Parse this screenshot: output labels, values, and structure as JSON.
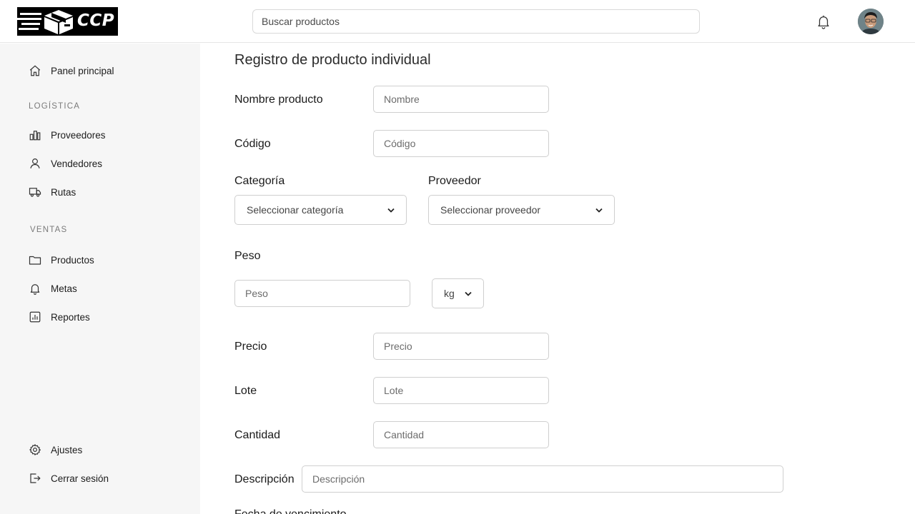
{
  "header": {
    "logo_text": "CCP",
    "search_placeholder": "Buscar productos"
  },
  "sidebar": {
    "home": "Panel principal",
    "section_logistica": "LOGÍSTICA",
    "logistica_items": [
      "Proveedores",
      "Vendedores",
      "Rutas"
    ],
    "section_ventas": "VENTAS",
    "ventas_items": [
      "Productos",
      "Metas",
      "Reportes"
    ],
    "settings": "Ajustes",
    "logout": "Cerrar sesión"
  },
  "form": {
    "title": "Registro de producto individual",
    "nombre_label": "Nombre producto",
    "nombre_placeholder": "Nombre",
    "codigo_label": "Código",
    "codigo_placeholder": "Código",
    "categoria_label": "Categoría",
    "categoria_select": "Seleccionar categoría",
    "proveedor_label": "Proveedor",
    "proveedor_select": "Seleccionar proveedor",
    "peso_label": "Peso",
    "peso_placeholder": "Peso",
    "peso_unit": "kg",
    "precio_label": "Precio",
    "precio_placeholder": "Precio",
    "lote_label": "Lote",
    "lote_placeholder": "Lote",
    "cantidad_label": "Cantidad",
    "cantidad_placeholder": "Cantidad",
    "descripcion_label": "Descripción",
    "descripcion_placeholder": "Descripción",
    "next_label_partial": "Fecha de vencimiento"
  },
  "icons": {
    "home": "home-icon",
    "proveedores": "bar-chart-icon",
    "vendedores": "user-icon",
    "rutas": "truck-icon",
    "productos": "folder-icon",
    "metas": "bell-icon",
    "reportes": "report-icon",
    "ajustes": "gear-icon",
    "logout": "logout-icon",
    "notifications": "bell-icon"
  }
}
